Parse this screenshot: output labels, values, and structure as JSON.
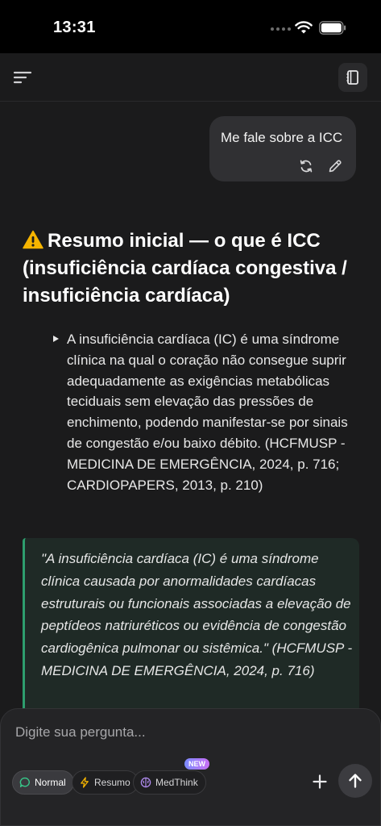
{
  "status_bar": {
    "time": "13:31",
    "icons": [
      "signal-dots-icon",
      "wifi-icon",
      "battery-icon"
    ]
  },
  "header": {
    "menu_icon": "menu-icon",
    "notebook_icon": "notebook-icon"
  },
  "conversation": {
    "user_message": "Me fale sobre a ICC",
    "user_actions": [
      "regenerate-icon",
      "edit-icon"
    ],
    "answer": {
      "heading_icon": "warning-icon",
      "heading": "Resumo inicial — o que é ICC (insuficiência cardíaca congestiva / insuficiência cardíaca)",
      "bullets": [
        "A insuficiência cardíaca (IC) é uma síndrome clínica na qual o coração não consegue suprir adequadamente as exigências metabólicas teciduais sem elevação das pressões de enchimento, podendo manifestar-se por sinais de congestão e/ou baixo débito. (HCFMUSP - MEDICINA DE EMERGÊNCIA, 2024, p. 716; CARDIOPAPERS, 2013, p. 210)"
      ],
      "quote": "\"A insuficiência cardíaca (IC) é uma síndrome clínica causada por anormalidades cardíacas estruturais ou funcionais associadas a elevação de peptídeos natriuréticos ou evidência de congestão cardiogênica pulmonar ou sistêmica.\" (HCFMUSP - MEDICINA DE EMERGÊNCIA, 2024, p. 716)"
    }
  },
  "composer": {
    "placeholder": "Digite sua pergunta...",
    "modes": [
      {
        "label": "Normal",
        "icon": "chat-bubble-icon",
        "active": true
      },
      {
        "label": "Resumo",
        "icon": "lightning-icon",
        "active": false
      },
      {
        "label": "MedThink",
        "icon": "brain-icon",
        "active": false
      }
    ],
    "new_badge": "NEW",
    "add_icon": "plus-icon",
    "send_icon": "arrow-up-icon"
  },
  "colors": {
    "background": "#1b1b1c",
    "bubble": "#303033",
    "quote_bg": "#1f2a26",
    "quote_border": "#2e9e6e",
    "warning": "#f5b400",
    "resumo_icon": "#f5b400",
    "medthink_icon": "#b18cf0",
    "normal_icon": "#37c98a"
  }
}
